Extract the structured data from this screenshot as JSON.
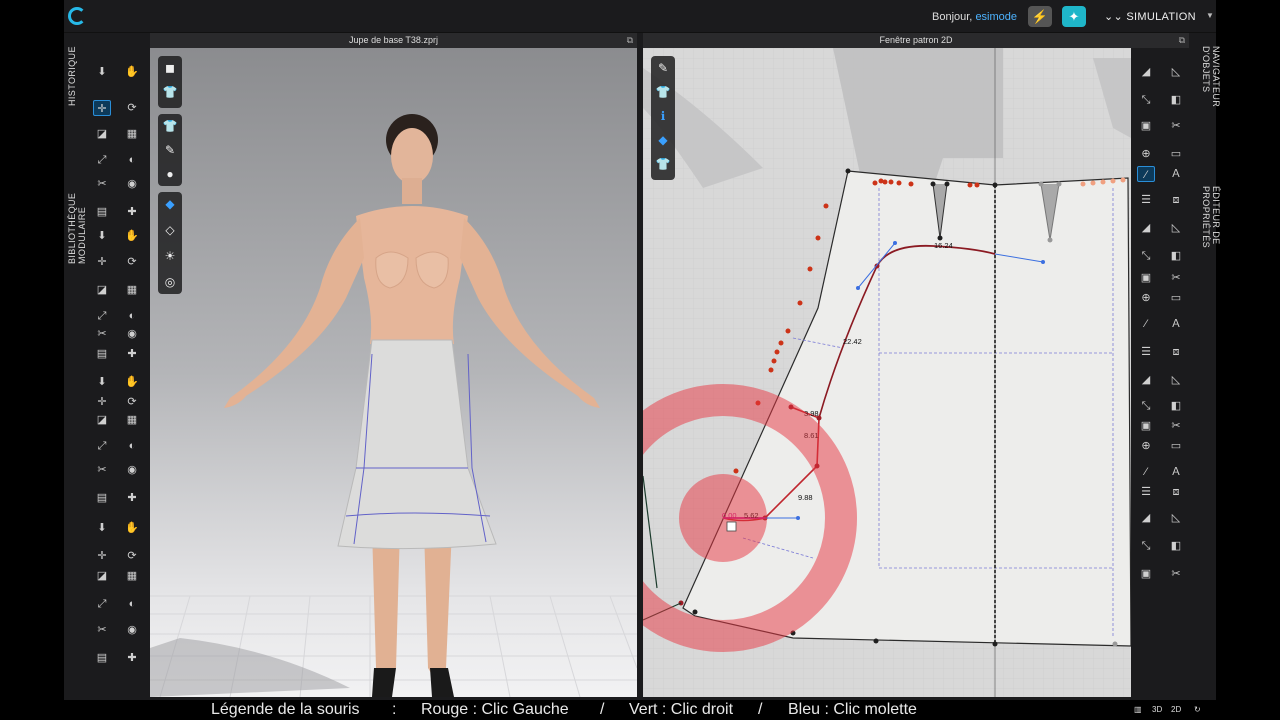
{
  "topbar": {
    "greeting": "Bonjour,",
    "username": "esimode",
    "simulation_label": "SIMULATION",
    "logo_icon": "clo-logo-icon",
    "accent": "#27b9e8"
  },
  "left_tabs": {
    "history": "HISTORIQUE",
    "library": "BIBLIOTHÈQUE MODULAIRE"
  },
  "right_tabs": {
    "navigator": "NAVIGATEUR D'OBJETS",
    "properties": "ÉDITEUR DE PROPRIÉTÉS"
  },
  "panel3d": {
    "title": "Jupe de base T38.zprj"
  },
  "panel2d": {
    "title": "Fenêtre patron 2D"
  },
  "measurements": [
    "16.24",
    "22.42",
    "3.98",
    "8.61",
    "9.88",
    "0.00",
    "5.62"
  ],
  "legend": {
    "title": "Légende de la souris",
    "sep1": ":",
    "red": "Rouge : Clic Gauche",
    "sep2": "/",
    "green": "Vert : Clic droit",
    "sep3": "/",
    "blue": "Bleu : Clic molette"
  },
  "view_buttons": [
    "3D",
    "2D"
  ],
  "colors": {
    "curve_red": "#c0262e",
    "point_red": "#cc3318",
    "handle_blue": "#3b6fe0",
    "magenta": "#c2188a",
    "click_marker": "#e8343f"
  }
}
